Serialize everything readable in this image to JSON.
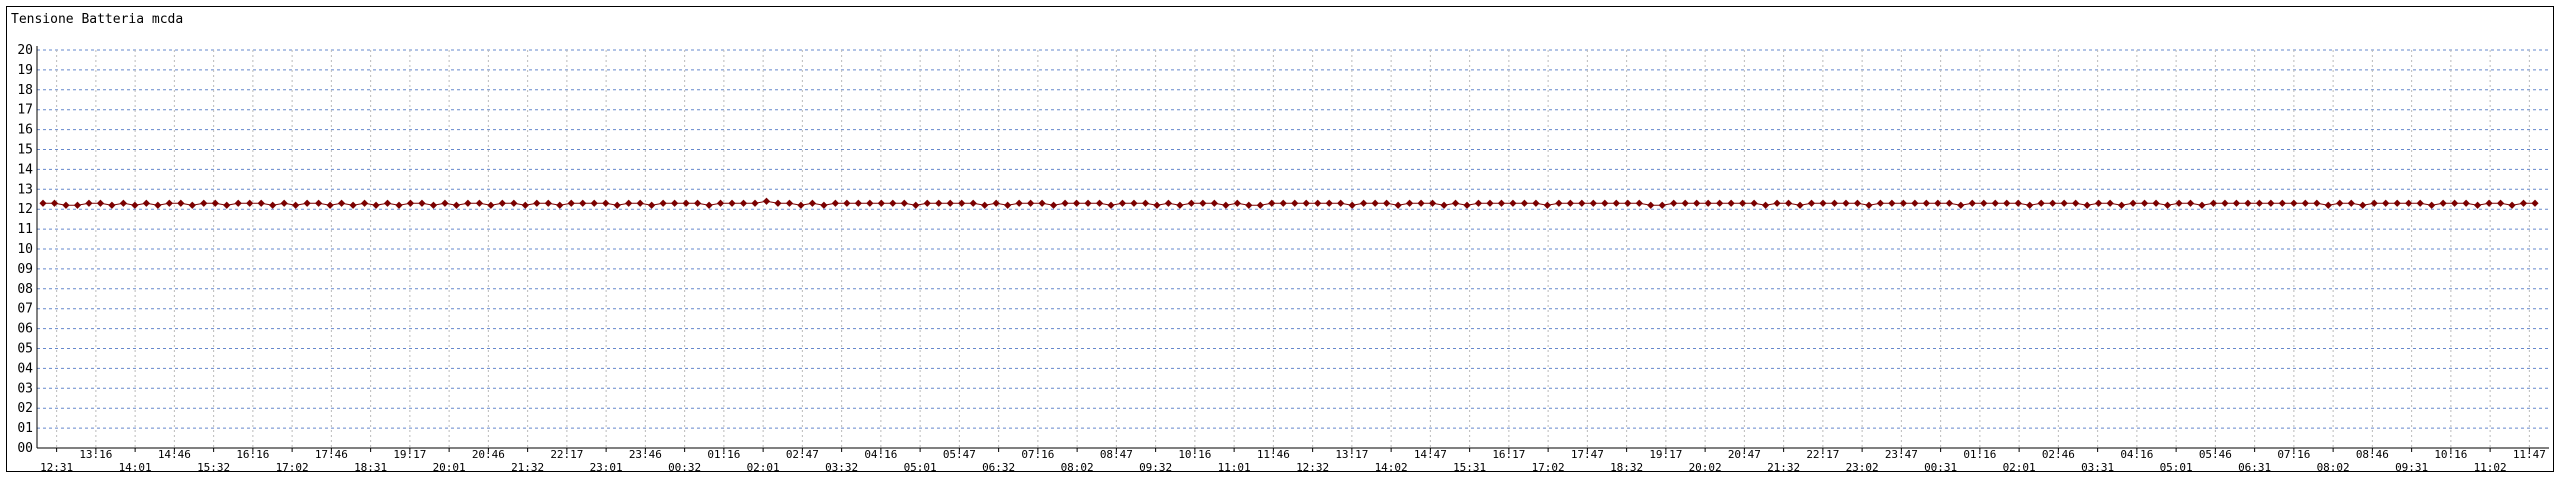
{
  "chart_data": {
    "type": "line",
    "title": "Tensione Batteria mcda",
    "xlabel": "",
    "ylabel": "",
    "ylim": [
      0,
      20
    ],
    "y_ticks": [
      "00",
      "01",
      "02",
      "03",
      "04",
      "05",
      "06",
      "07",
      "08",
      "09",
      "10",
      "11",
      "12",
      "13",
      "14",
      "15",
      "16",
      "17",
      "18",
      "19",
      "20"
    ],
    "x_ticks": [
      "12:31",
      "13:16",
      "14:01",
      "14:46",
      "15:32",
      "16:16",
      "17:02",
      "17:46",
      "18:31",
      "19:17",
      "20:01",
      "20:46",
      "21:32",
      "22:17",
      "23:01",
      "23:46",
      "00:32",
      "01:16",
      "02:01",
      "02:47",
      "03:32",
      "04:16",
      "05:01",
      "05:47",
      "06:32",
      "07:16",
      "08:02",
      "08:47",
      "09:32",
      "10:16",
      "11:01",
      "11:46",
      "12:32",
      "13:17",
      "14:02",
      "14:47",
      "15:31",
      "16:17",
      "17:02",
      "17:47",
      "18:32",
      "19:17",
      "20:02",
      "20:47",
      "21:32",
      "22:17",
      "23:02",
      "23:47",
      "00:31",
      "01:16",
      "02:01",
      "02:46",
      "03:31",
      "04:16",
      "05:01",
      "05:46",
      "06:31",
      "07:16",
      "08:02",
      "08:46",
      "09:31",
      "10:16",
      "11:02",
      "11:47"
    ],
    "grid": true,
    "series": [
      {
        "values": [
          12.3,
          12.3,
          12.2,
          12.2,
          12.3,
          12.3,
          12.2,
          12.3,
          12.2,
          12.3,
          12.2,
          12.3,
          12.3,
          12.2,
          12.3,
          12.3,
          12.2,
          12.3,
          12.3,
          12.3,
          12.2,
          12.3,
          12.2,
          12.3,
          12.3,
          12.2,
          12.3,
          12.2,
          12.3,
          12.2,
          12.3,
          12.2,
          12.3,
          12.3,
          12.2,
          12.3,
          12.2,
          12.3,
          12.3,
          12.2,
          12.3,
          12.3,
          12.2,
          12.3,
          12.3,
          12.2,
          12.3,
          12.3,
          12.3,
          12.3,
          12.2,
          12.3,
          12.3,
          12.2,
          12.3,
          12.3,
          12.3,
          12.3,
          12.2,
          12.3,
          12.3,
          12.3,
          12.3,
          12.4,
          12.3,
          12.3,
          12.2,
          12.3,
          12.2,
          12.3,
          12.3,
          12.3,
          12.3,
          12.3,
          12.3,
          12.3,
          12.2,
          12.3,
          12.3,
          12.3,
          12.3,
          12.3,
          12.2,
          12.3,
          12.2,
          12.3,
          12.3,
          12.3,
          12.2,
          12.3,
          12.3,
          12.3,
          12.3,
          12.2,
          12.3,
          12.3,
          12.3,
          12.2,
          12.3,
          12.2,
          12.3,
          12.3,
          12.3,
          12.2,
          12.3,
          12.2,
          12.2,
          12.3,
          12.3,
          12.3,
          12.3,
          12.3,
          12.3,
          12.3,
          12.2,
          12.3,
          12.3,
          12.3,
          12.2,
          12.3,
          12.3,
          12.3,
          12.2,
          12.3,
          12.2,
          12.3,
          12.3,
          12.3,
          12.3,
          12.3,
          12.3,
          12.2,
          12.3,
          12.3,
          12.3,
          12.3,
          12.3,
          12.3,
          12.3,
          12.3,
          12.2,
          12.2,
          12.3,
          12.3,
          12.3,
          12.3,
          12.3,
          12.3,
          12.3,
          12.3,
          12.2,
          12.3,
          12.3,
          12.2,
          12.3,
          12.3,
          12.3,
          12.3,
          12.3,
          12.2,
          12.3,
          12.3,
          12.3,
          12.3,
          12.3,
          12.3,
          12.3,
          12.2,
          12.3,
          12.3,
          12.3,
          12.3,
          12.3,
          12.2,
          12.3,
          12.3,
          12.3,
          12.3,
          12.2,
          12.3,
          12.3,
          12.2,
          12.3,
          12.3,
          12.3,
          12.2,
          12.3,
          12.3,
          12.2,
          12.3,
          12.3,
          12.3,
          12.3,
          12.3,
          12.3,
          12.3,
          12.3,
          12.3,
          12.3,
          12.2,
          12.3,
          12.3,
          12.2,
          12.3,
          12.3,
          12.3,
          12.3,
          12.3,
          12.2,
          12.3,
          12.3,
          12.3,
          12.2,
          12.3,
          12.3,
          12.2,
          12.3,
          12.3
        ],
        "color": "#7a0000"
      }
    ],
    "colors": {
      "major_grid": "#6688cc",
      "minor_grid": "#bbbbbb",
      "marker": "#7a0000"
    }
  }
}
